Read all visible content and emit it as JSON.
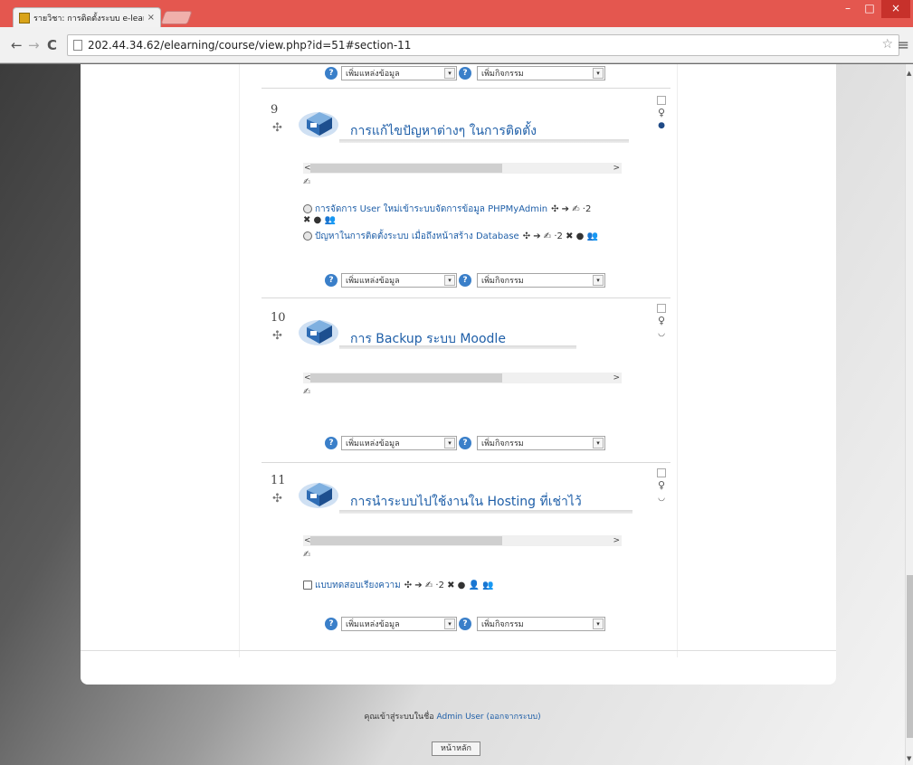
{
  "browser": {
    "tab_title": "รายวิชา: การติดตั้งระบบ e-lear",
    "tab_close": "×",
    "url": "202.44.34.62/elearning/course/view.php?id=51#section-11",
    "nav_back": "←",
    "nav_forward": "→",
    "nav_reload": "C",
    "star": "☆",
    "menu": "≡",
    "win_min": "–",
    "win_max": "□",
    "win_close": "×"
  },
  "add_controls": {
    "help": "?",
    "resource_label": "เพิ่มแหล่งข้อมูล",
    "activity_label": "เพิ่มกิจกรรม",
    "caret": "▾"
  },
  "icons": {
    "move": "✣",
    "edit": "✍",
    "bulb": "♀",
    "eye_open": "●",
    "eye_closed": "◡",
    "slider_left": "<",
    "slider_right": ">"
  },
  "sections": [
    {
      "number": "9",
      "title": "การแก้ไขปัญหาต่างๆ ในการติดตั้ง",
      "visibility_icon": "●",
      "activities": [
        {
          "name": "การจัดการ User ใหม่เข้าระบบจัดการข้อมูล PHPMyAdmin",
          "controls": "✣ ➔ ✍ ·2",
          "controls_line2": "✖ ● 👥"
        },
        {
          "name": "ปัญหาในการติดตั้งระบบ เมื่อถึงหน้าสร้าง Database",
          "controls": "✣ ➔ ✍ ·2 ✖ ● 👥",
          "controls_line2": ""
        }
      ]
    },
    {
      "number": "10",
      "title": "การ Backup ระบบ Moodle",
      "visibility_icon": "◡",
      "activities": []
    },
    {
      "number": "11",
      "title": "การนำระบบไปใช้งานใน Hosting ที่เช่าไว้",
      "visibility_icon": "◡",
      "activities": [
        {
          "name": "แบบทดสอบเรียงความ",
          "controls": "✣ ➔ ✍ ·2 ✖ ● 👤 👥",
          "controls_line2": ""
        }
      ]
    }
  ],
  "footer": {
    "logged_in_prefix": "คุณเข้าสู่ระบบในชื่อ",
    "user_link": "Admin User",
    "logout": "(ออกจากระบบ)",
    "home_button": "หน้าหลัก"
  }
}
